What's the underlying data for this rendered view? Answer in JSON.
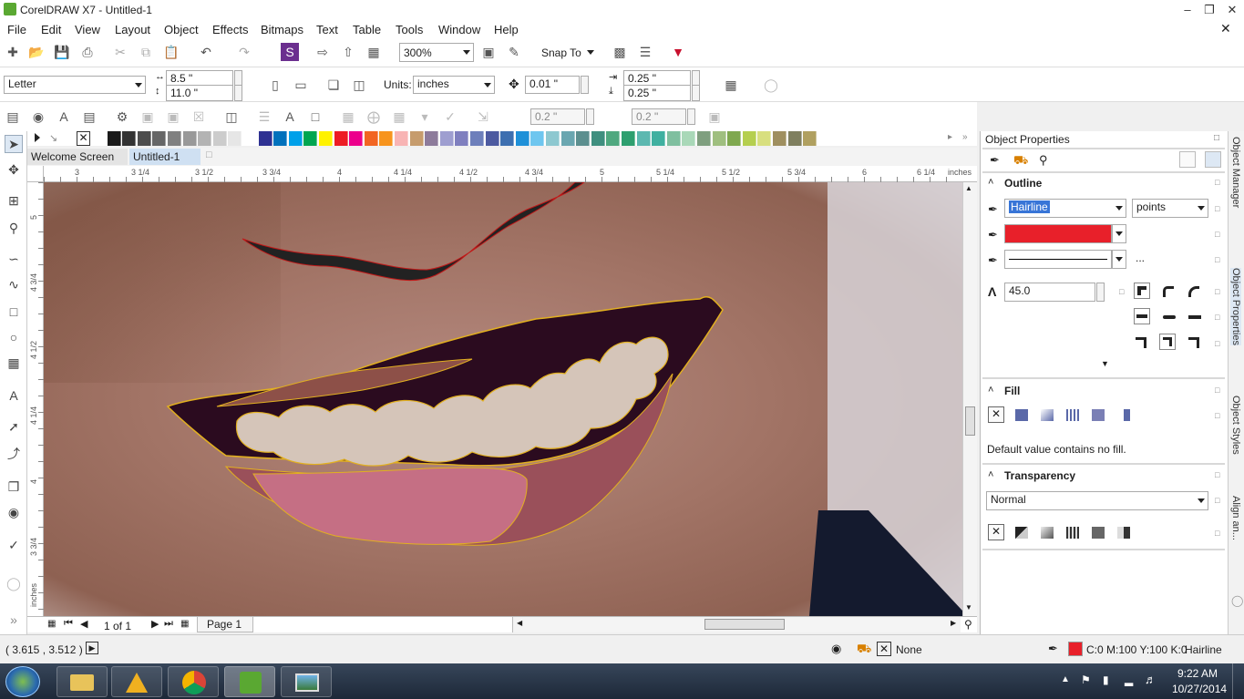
{
  "window": {
    "title": "CorelDRAW X7 - Untitled-1"
  },
  "menu": [
    "File",
    "Edit",
    "View",
    "Layout",
    "Object",
    "Effects",
    "Bitmaps",
    "Text",
    "Table",
    "Tools",
    "Window",
    "Help"
  ],
  "toolbar": {
    "zoom": "300%",
    "snap_to": "Snap To"
  },
  "propbar": {
    "page_size": "Letter",
    "width": "8.5 \"",
    "height": "11.0 \"",
    "units_label": "Units:",
    "units": "inches",
    "nudge": "0.01 \"",
    "dup_x": "0.25 \"",
    "dup_y": "0.25 \""
  },
  "bar3": {
    "field1": "0.2 \"",
    "field2": "0.2 \""
  },
  "tabs": {
    "welcome": "Welcome Screen",
    "doc": "Untitled-1"
  },
  "ruler": {
    "h": [
      "3",
      "3 1/4",
      "3 1/2",
      "3 3/4",
      "4",
      "4 1/4",
      "4 1/2",
      "4 3/4",
      "5",
      "5 1/4",
      "5 1/2",
      "5 3/4",
      "6",
      "6 1/4"
    ],
    "units": "inches",
    "v": [
      "5",
      "4 3/4",
      "4 1/2",
      "4 1/4",
      "4",
      "3 3/4"
    ],
    "v_units": "inches"
  },
  "pagebar": {
    "count": "1 of 1",
    "page": "Page 1"
  },
  "docker": {
    "title": "Object Properties",
    "outline": {
      "header": "Outline",
      "width": "Hairline",
      "units": "points",
      "color": "#e8202a",
      "miter": "45.0",
      "more": "..."
    },
    "fill": {
      "header": "Fill",
      "message": "Default value contains no fill."
    },
    "transparency": {
      "header": "Transparency",
      "mode": "Normal"
    }
  },
  "side_tabs": [
    "Object Manager",
    "Object Properties",
    "Object Styles",
    "Align an..."
  ],
  "status": {
    "coords": "( 3.615 , 3.512 )",
    "fill": "None",
    "outline_color": "C:0 M:100 Y:100 K:0",
    "outline_width": "Hairline"
  },
  "clock": {
    "time": "9:22 AM",
    "date": "10/27/2014"
  },
  "palette": [
    "#ffffff",
    "#1a1a1a",
    "#333333",
    "#4d4d4d",
    "#666666",
    "#808080",
    "#999999",
    "#b3b3b3",
    "#cccccc",
    "#e6e6e6",
    "#ffffff",
    "#2e3192",
    "#0071bc",
    "#00a0e9",
    "#00a651",
    "#fff200",
    "#ed1c24",
    "#ec008c",
    "#f26522",
    "#f7941d",
    "#f8b4b4",
    "#c69c6d",
    "#8d7b9b",
    "#9e9ed0",
    "#7f7fbf",
    "#6d7fbb",
    "#4d5aa0",
    "#3d6fb0",
    "#1e90d8",
    "#6ec6ef",
    "#8dc8d0",
    "#6aa6b0",
    "#5c8f8f",
    "#3f8f7f",
    "#4fa87f",
    "#2e9f6f",
    "#5cb8b0",
    "#3fb0a0",
    "#7fbf9f",
    "#a9d8b8",
    "#7f9f7f",
    "#9fbf7f",
    "#7fa84f",
    "#b5cf4f",
    "#d8df7f",
    "#9f8f5f",
    "#7f7f5f",
    "#b0a060"
  ]
}
